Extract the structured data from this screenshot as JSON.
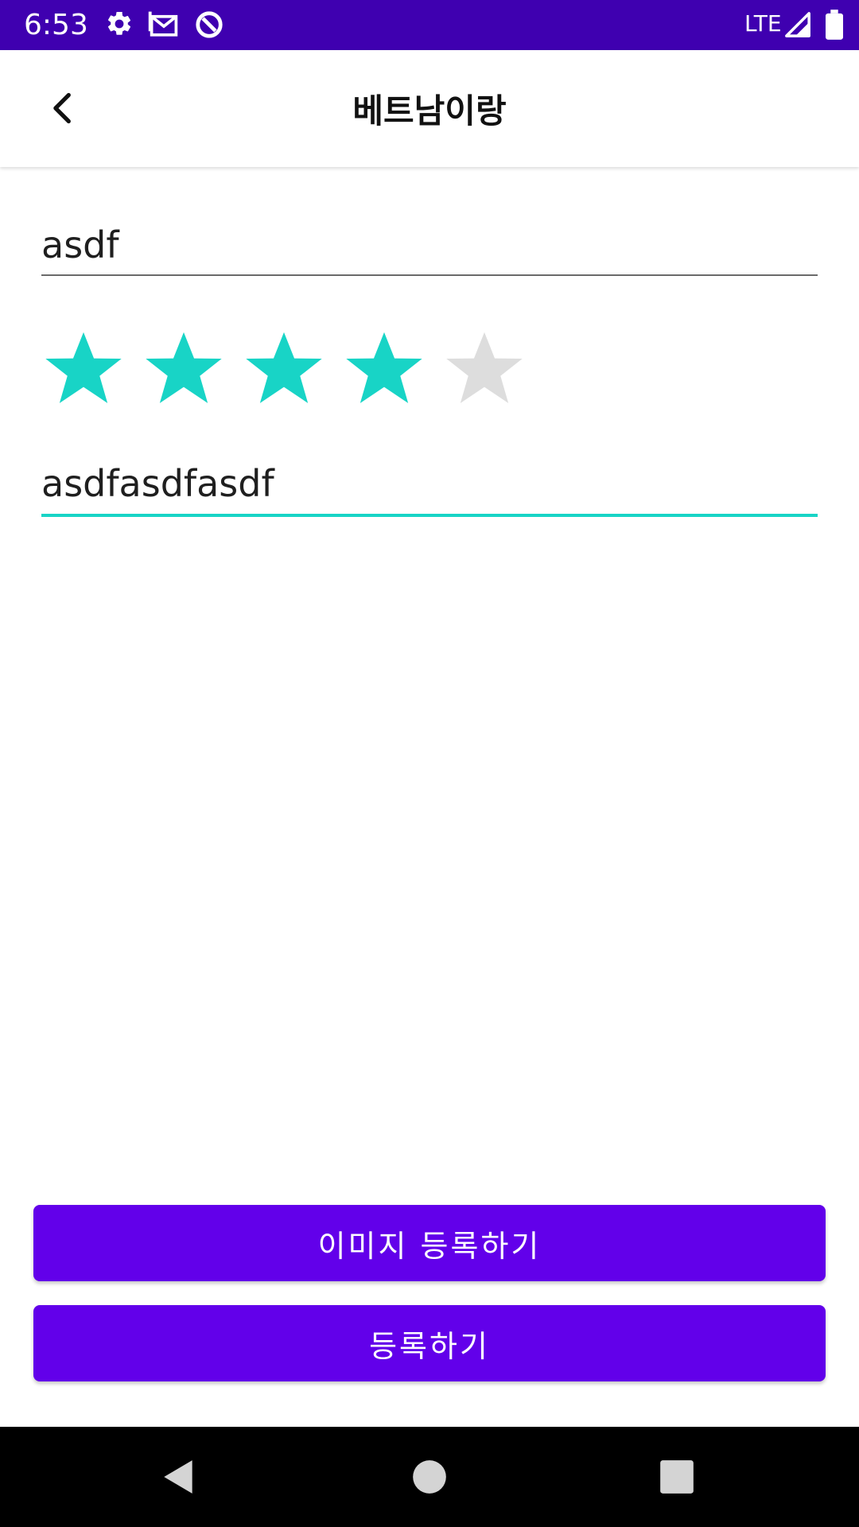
{
  "status_bar": {
    "time": "6:53",
    "network": "LTE",
    "bg_color": "#3f00b0",
    "icons": [
      "settings-icon",
      "gmail-icon",
      "data-saver-icon",
      "signal-icon",
      "battery-icon"
    ]
  },
  "app_bar": {
    "title": "베트남이랑",
    "back_icon": "back-arrow-icon"
  },
  "form": {
    "title_value": "asdf",
    "rating": {
      "value": 4,
      "max": 5,
      "filled_color": "#18d4c6",
      "empty_color": "#dddddd"
    },
    "review_value": "asdfasdfasdf"
  },
  "buttons": {
    "register_image": "이미지 등록하기",
    "register": "등록하기",
    "color": "#6200ea"
  },
  "nav_bar": {
    "icons": [
      "back-triangle-icon",
      "home-circle-icon",
      "recents-square-icon"
    ]
  }
}
